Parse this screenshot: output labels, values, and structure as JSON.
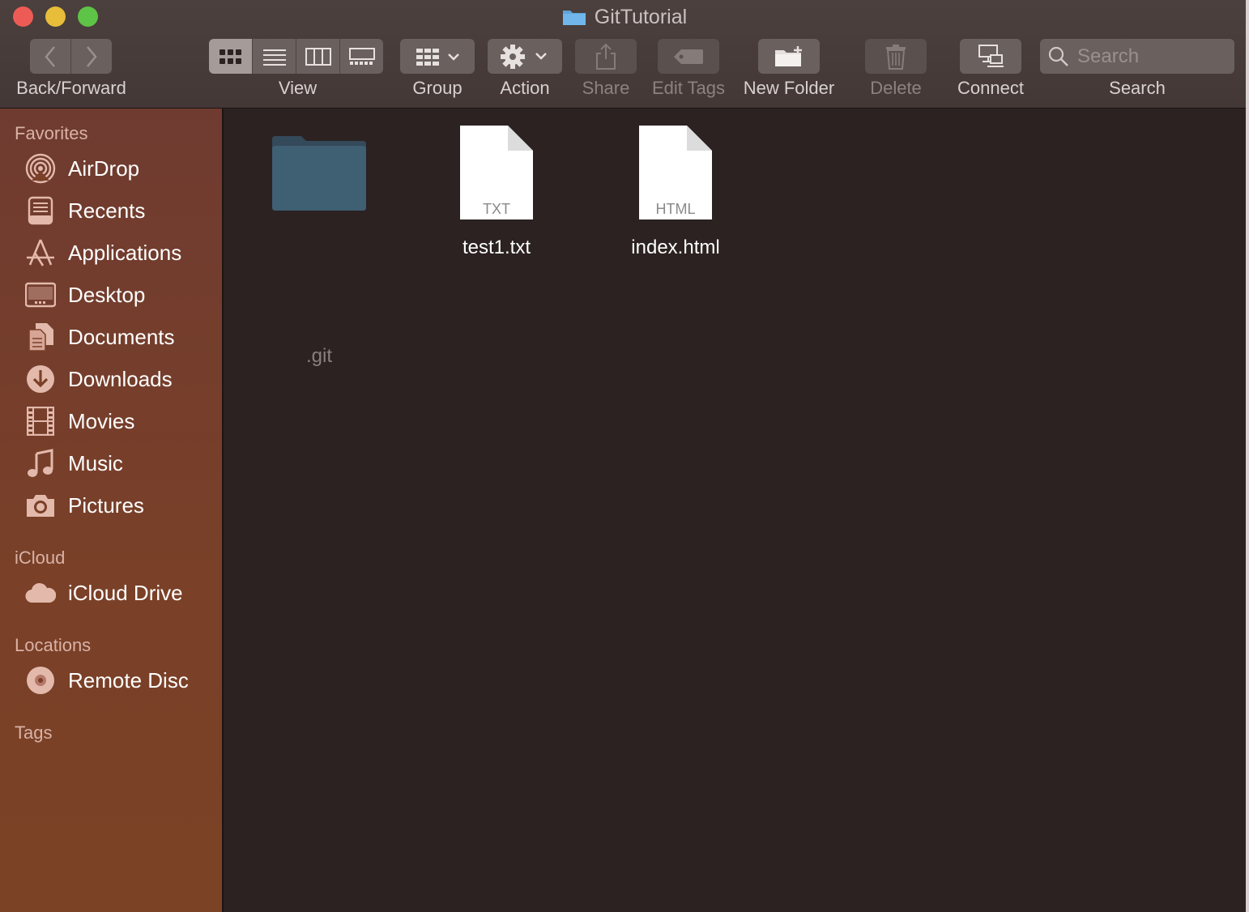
{
  "window": {
    "title": "GitTutorial"
  },
  "toolbar": {
    "back_forward_label": "Back/Forward",
    "view_label": "View",
    "group_label": "Group",
    "action_label": "Action",
    "share_label": "Share",
    "edit_tags_label": "Edit Tags",
    "new_folder_label": "New Folder",
    "delete_label": "Delete",
    "connect_label": "Connect",
    "search_label": "Search",
    "search_placeholder": "Search"
  },
  "sidebar": {
    "favorites_header": "Favorites",
    "favorites": [
      {
        "label": "AirDrop",
        "icon": "airdrop-icon"
      },
      {
        "label": "Recents",
        "icon": "recents-icon"
      },
      {
        "label": "Applications",
        "icon": "applications-icon"
      },
      {
        "label": "Desktop",
        "icon": "desktop-icon"
      },
      {
        "label": "Documents",
        "icon": "documents-icon"
      },
      {
        "label": "Downloads",
        "icon": "downloads-icon"
      },
      {
        "label": "Movies",
        "icon": "movies-icon"
      },
      {
        "label": "Music",
        "icon": "music-icon"
      },
      {
        "label": "Pictures",
        "icon": "pictures-icon"
      }
    ],
    "icloud_header": "iCloud",
    "icloud": [
      {
        "label": "iCloud Drive",
        "icon": "icloud-drive-icon"
      }
    ],
    "locations_header": "Locations",
    "locations": [
      {
        "label": "Remote Disc",
        "icon": "remote-disc-icon"
      }
    ],
    "tags_header": "Tags"
  },
  "files": [
    {
      "name": ".git",
      "kind": "folder"
    },
    {
      "name": "test1.txt",
      "kind": "document",
      "badge": "TXT"
    },
    {
      "name": "index.html",
      "kind": "document",
      "badge": "HTML"
    }
  ],
  "colors": {
    "sidebar_top": "#6f3b30",
    "sidebar_bottom": "#7b4226",
    "content_bg": "#2b2221",
    "folder_blue": "#3f5f73"
  }
}
